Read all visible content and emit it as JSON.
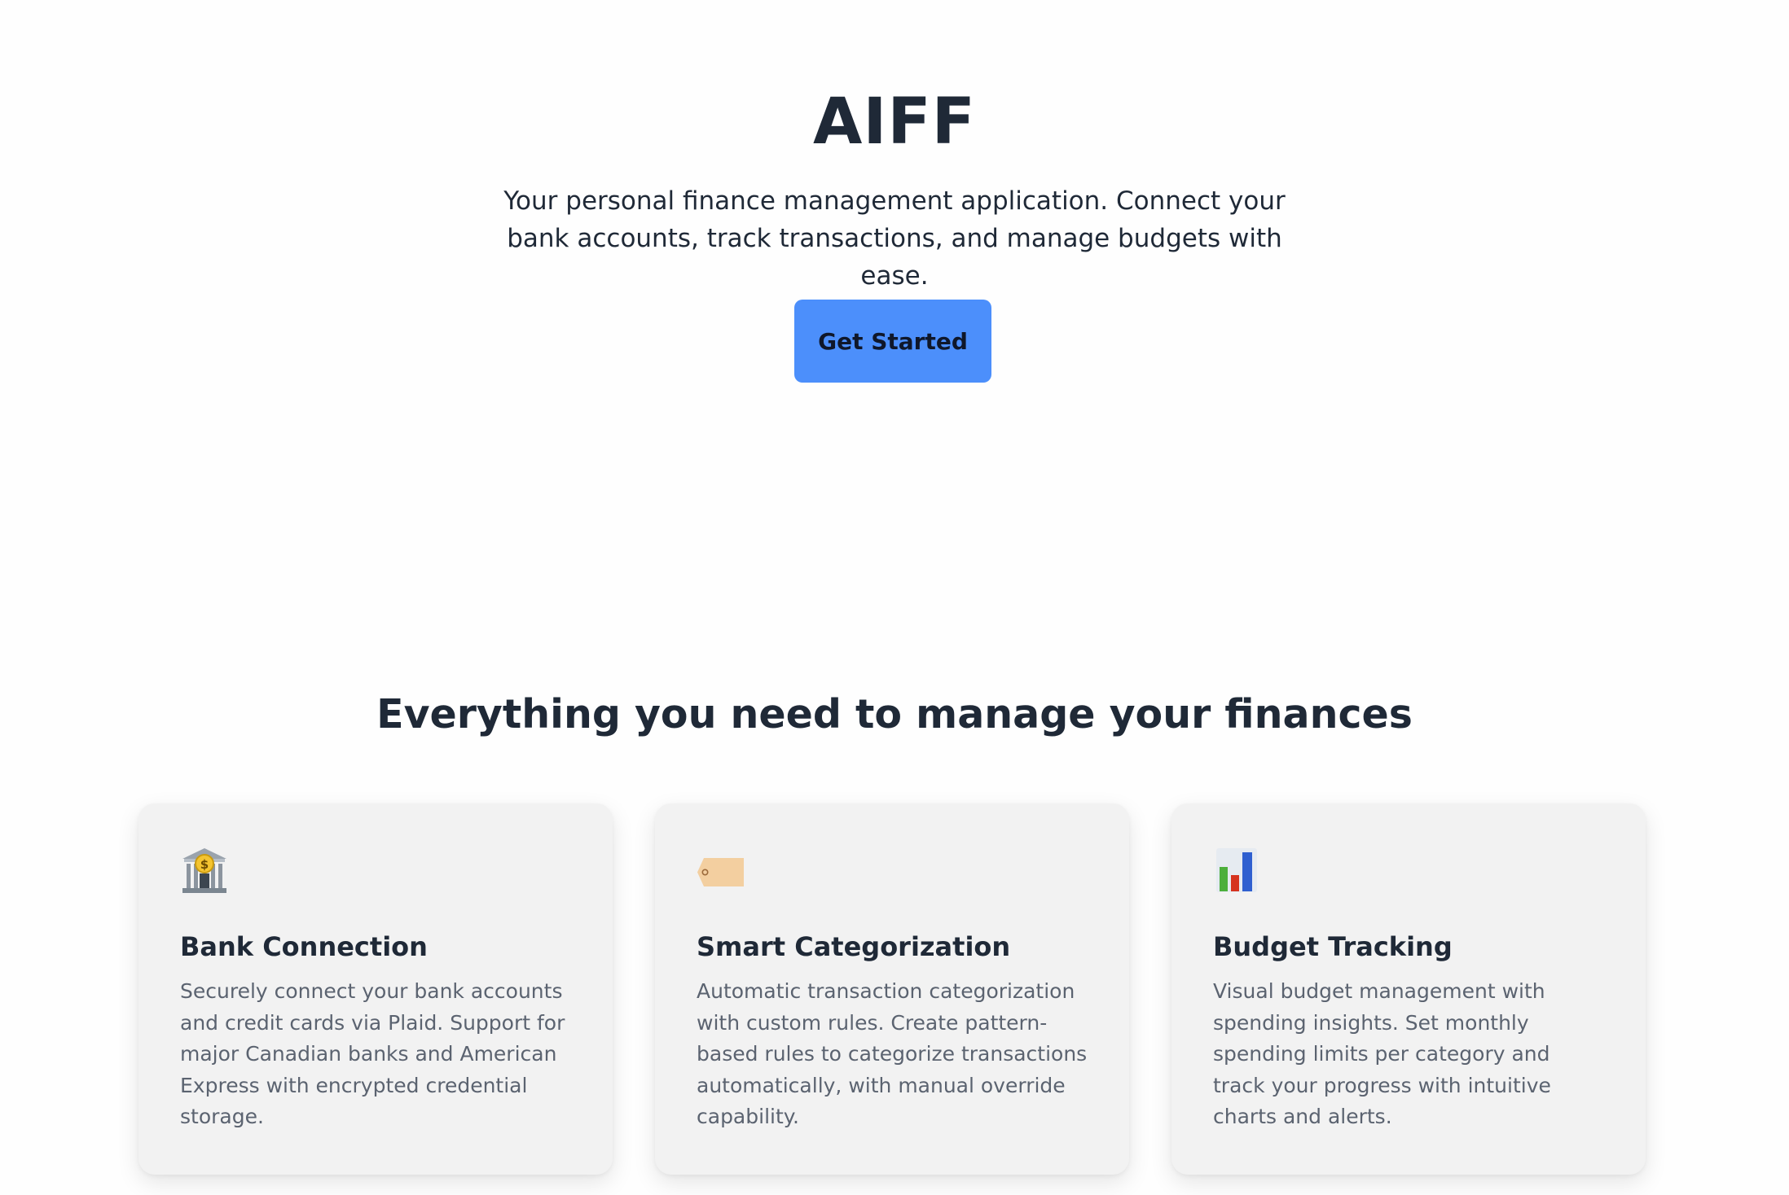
{
  "hero": {
    "title": "AIFF",
    "subtitle": "Your personal finance management application. Connect your bank accounts, track transactions, and manage budgets with ease.",
    "cta_label": "Get Started",
    "cta_color": "#4c8ffb"
  },
  "features": {
    "heading": "Everything you need to manage your finances",
    "cards": [
      {
        "icon": "bank-icon",
        "title": "Bank Connection",
        "description": "Securely connect your bank accounts and credit cards via Plaid. Support for major Canadian banks and American Express with encrypted credential storage."
      },
      {
        "icon": "label-tag-icon",
        "title": "Smart Categorization",
        "description": "Automatic transaction categorization with custom rules. Create pattern-based rules to categorize transactions automatically, with manual override capability."
      },
      {
        "icon": "bar-chart-icon",
        "title": "Budget Tracking",
        "description": "Visual budget management with spending insights. Set monthly spending limits per category and track your progress with intuitive charts and alerts."
      }
    ]
  }
}
